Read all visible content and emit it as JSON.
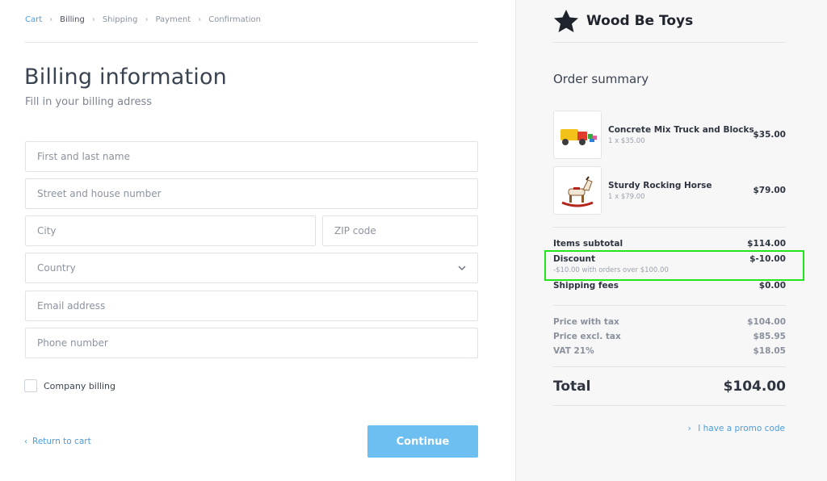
{
  "breadcrumb": {
    "items": [
      {
        "label": "Cart"
      },
      {
        "label": "Billing"
      },
      {
        "label": "Shipping"
      },
      {
        "label": "Payment"
      },
      {
        "label": "Confirmation"
      }
    ],
    "separator": "›"
  },
  "billing": {
    "title": "Billing information",
    "subtitle": "Fill in your billing adress",
    "fields": {
      "name_placeholder": "First and last name",
      "street_placeholder": "Street and house number",
      "city_placeholder": "City",
      "zip_placeholder": "ZIP code",
      "country_label": "Country",
      "email_placeholder": "Email address",
      "phone_placeholder": "Phone number"
    },
    "company_billing_label": "Company billing",
    "return_label": "Return to cart",
    "continue_label": "Continue",
    "chevron_left": "‹"
  },
  "brand": {
    "name": "Wood Be Toys",
    "icon": "star-icon"
  },
  "summary": {
    "title": "Order summary",
    "items": [
      {
        "name": "Concrete Mix Truck and Blocks",
        "qty": "1 x $35.00",
        "price": "$35.00",
        "icon": "toy-truck-image"
      },
      {
        "name": "Sturdy Rocking Horse",
        "qty": "1 x $79.00",
        "price": "$79.00",
        "icon": "rocking-horse-image"
      }
    ],
    "subtotal_label": "Items subtotal",
    "subtotal_value": "$114.00",
    "discount_label": "Discount",
    "discount_value": "$-10.00",
    "discount_note": "-$10.00 with orders over $100.00",
    "shipping_label": "Shipping fees",
    "shipping_value": "$0.00",
    "price_with_tax_label": "Price with tax",
    "price_with_tax_value": "$104.00",
    "price_excl_tax_label": "Price excl. tax",
    "price_excl_tax_value": "$85.95",
    "vat_label": "VAT 21%",
    "vat_value": "$18.05",
    "total_label": "Total",
    "total_value": "$104.00",
    "promo_label": "I have a promo code",
    "promo_chevron": "›"
  },
  "colors": {
    "accent": "#4a9ce0",
    "button": "#6cbff0",
    "highlight": "#22e51c",
    "panel_bg": "#f7f7f8"
  }
}
